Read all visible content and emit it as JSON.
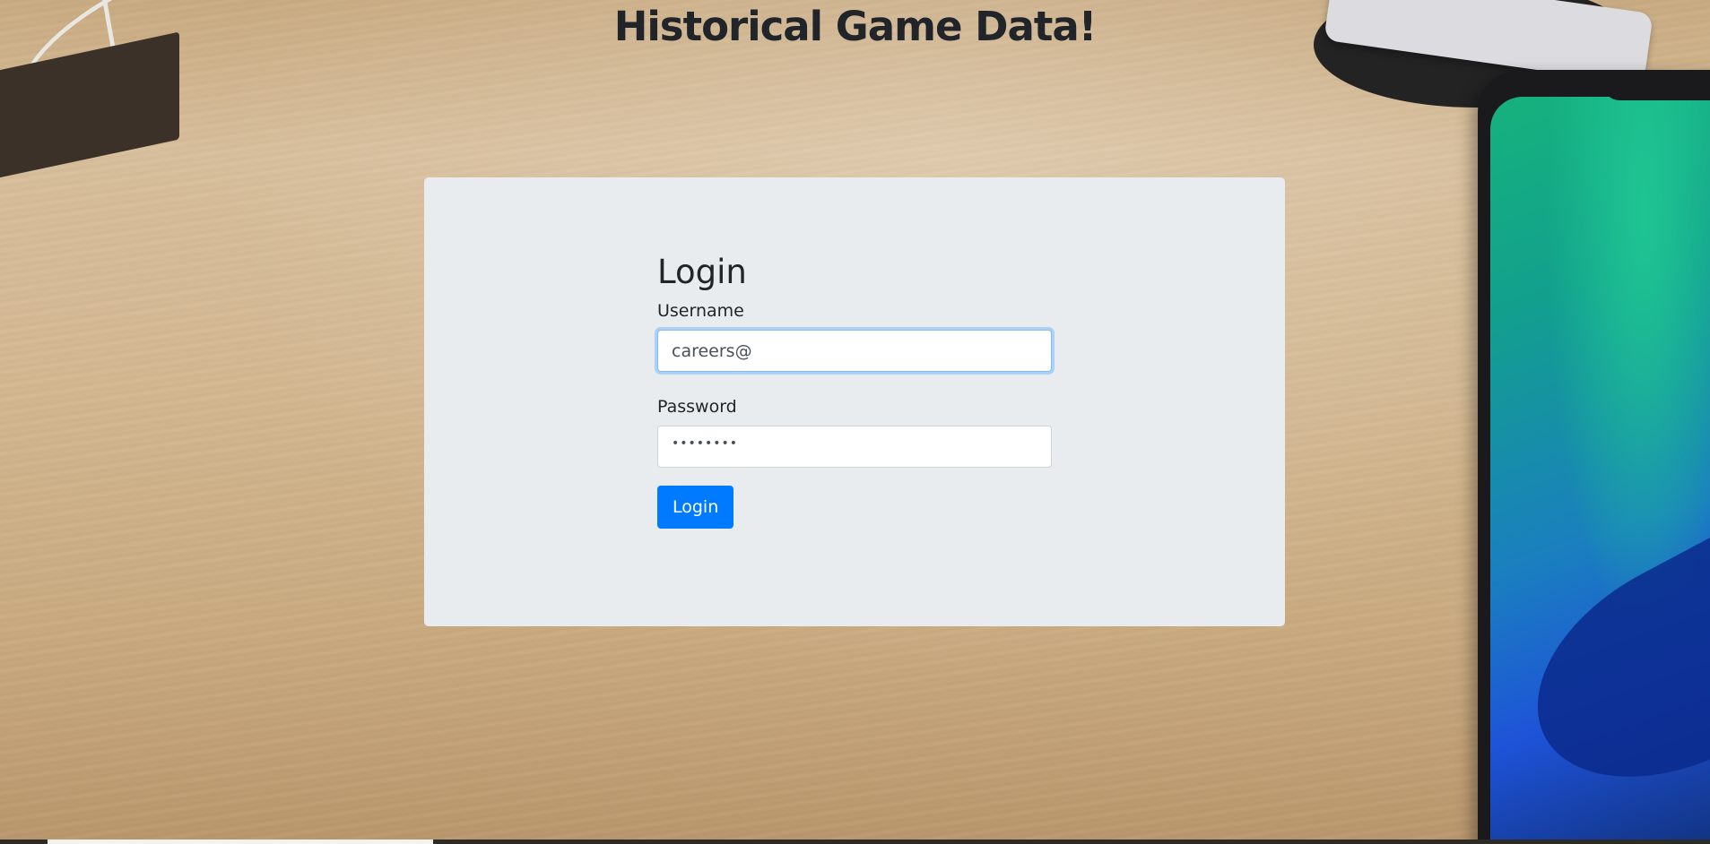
{
  "page": {
    "title": "Historical Game Data!"
  },
  "login": {
    "heading": "Login",
    "username_label": "Username",
    "username_value": "careers@",
    "password_label": "Password",
    "password_masked": "••••••••",
    "button_label": "Login"
  },
  "colors": {
    "primary": "#007bff",
    "panel_bg": "#e9ecef",
    "text": "#212529"
  }
}
